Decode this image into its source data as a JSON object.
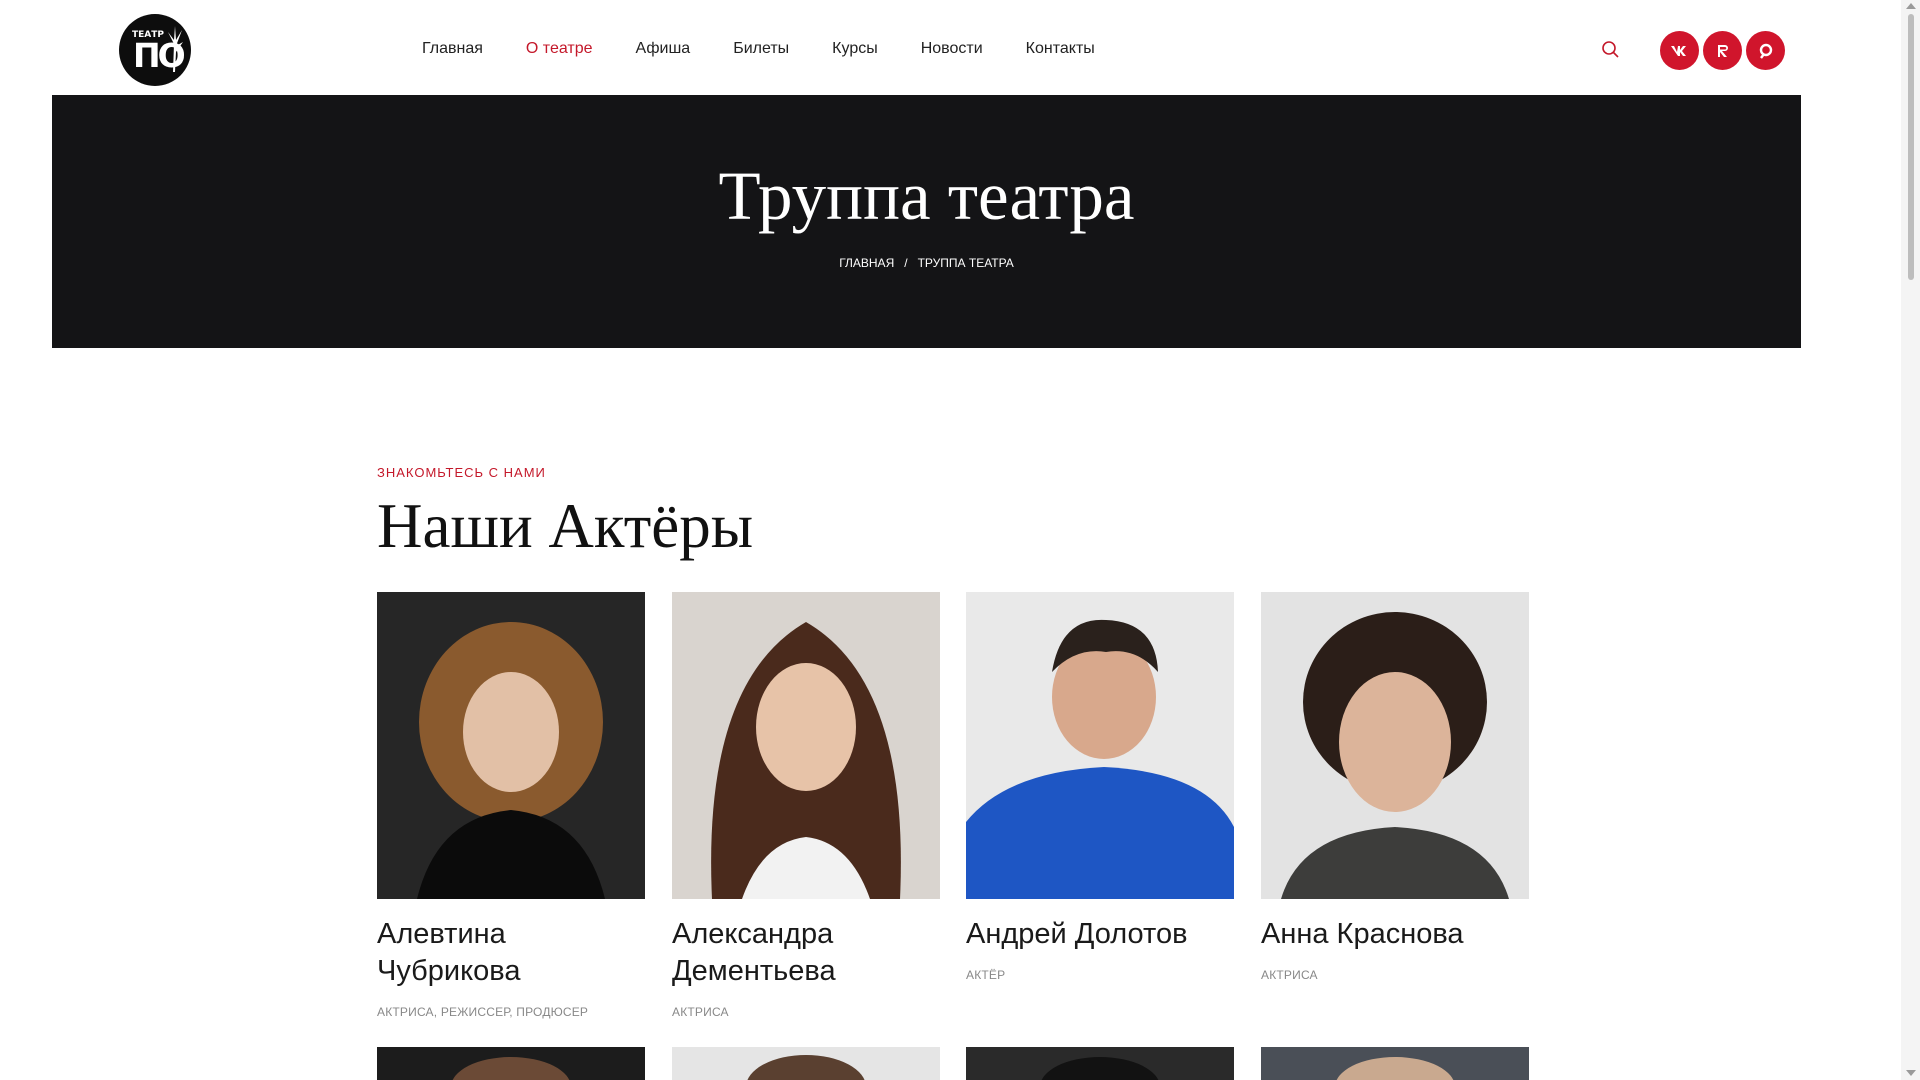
{
  "header": {
    "logo": {
      "small_text": "ТЕАТР",
      "big_text": "ПО"
    },
    "nav": [
      {
        "label": "Главная",
        "active": false
      },
      {
        "label": "О театре",
        "active": true
      },
      {
        "label": "Афиша",
        "active": false
      },
      {
        "label": "Билеты",
        "active": false
      },
      {
        "label": "Курсы",
        "active": false
      },
      {
        "label": "Новости",
        "active": false
      },
      {
        "label": "Контакты",
        "active": false
      }
    ],
    "search_icon": "search-icon",
    "socials": [
      {
        "name": "vk-icon",
        "glyph": "vk"
      },
      {
        "name": "rutube-icon",
        "glyph": "R"
      },
      {
        "name": "ok-icon",
        "glyph": "o"
      }
    ]
  },
  "hero": {
    "title": "Труппа театра",
    "breadcrumb": {
      "home": "Главная",
      "separator": "/",
      "current": "Труппа театра"
    }
  },
  "section": {
    "eyebrow": "Знакомьтесь с нами",
    "title": "Наши Актёры"
  },
  "actors": [
    {
      "name": "Алевтина Чубрикова",
      "role": "Актриса, режиссер, продюсер"
    },
    {
      "name": "Александра Дементьева",
      "role": "Актриса"
    },
    {
      "name": "Андрей Долотов",
      "role": "Актёр"
    },
    {
      "name": "Анна Краснова",
      "role": "Актриса"
    }
  ],
  "colors": {
    "accent": "#c4182a",
    "social": "#d0152c",
    "hero_bg": "#141416"
  }
}
